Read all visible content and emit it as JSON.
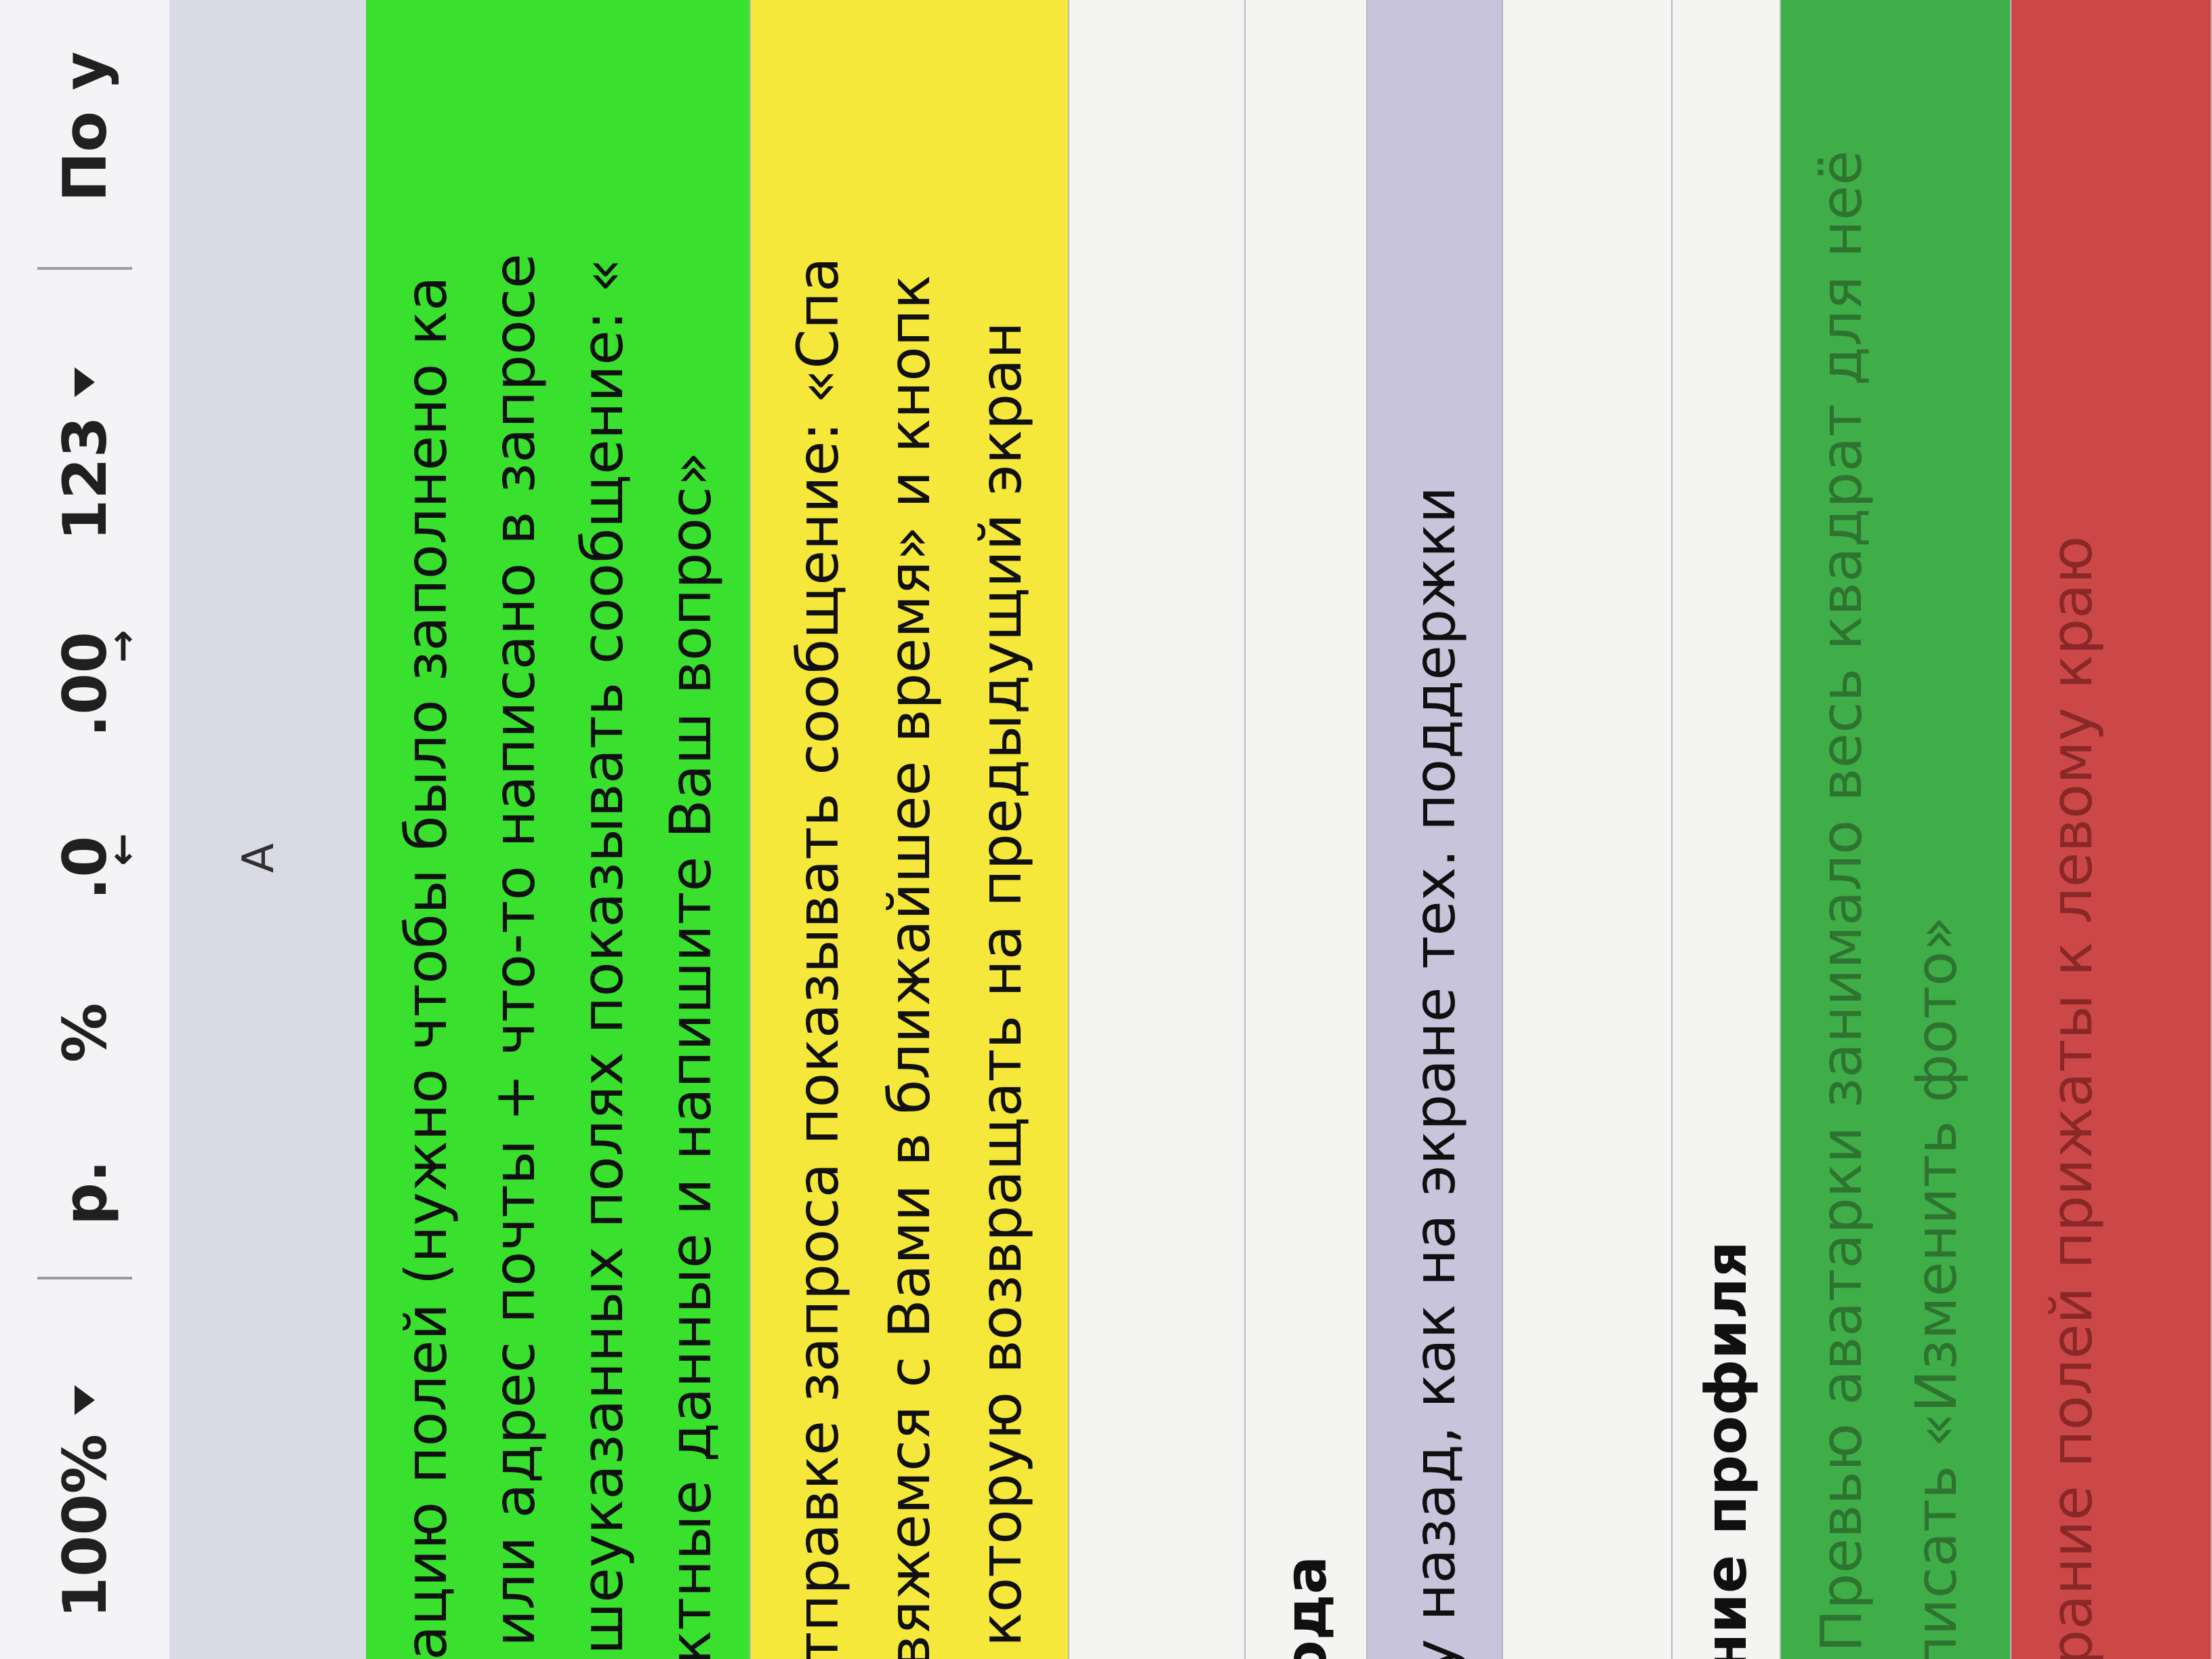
{
  "toolbar": {
    "zoom": "100%",
    "currency": "р.",
    "percent": "%",
    "decrease_decimal": ".0",
    "increase_decimal": ".00",
    "format_number": "123",
    "font_default": "По у"
  },
  "column_header": {
    "col_a": "A"
  },
  "rows": {
    "green_block": [
      "дацию полей (нужно чтобы было заполнено ка",
      "а или адрес почты + что-то написано в запросе",
      "ышеуказанных полях показывать сообщение: «",
      "актные данные и напишите Ваш вопрос»"
    ],
    "yellow_block": [
      "отправке запроса показывать сообщение: «Спа",
      "свяжемся с Вами в ближайшее время» и кнопк",
      "а которую возвращать на предыдущий экран"
    ],
    "section_title_1": "ода",
    "lavender_row": "у назад, как на экране тех. поддержки",
    "section_title_2": "ние профиля",
    "dkgreen_block": [
      "Превью аватарки занимало весь квадрат для неё",
      "писать «Изменить фото»"
    ],
    "red_block": "рание полей прижаты к левому краю"
  }
}
